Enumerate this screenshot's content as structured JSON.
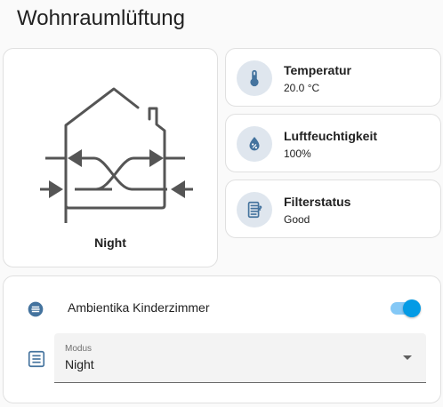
{
  "header": {
    "title": "Wohnraumlüftung"
  },
  "unit": {
    "mode_label": "Night"
  },
  "sensors": [
    {
      "name": "Temperatur",
      "value": "20.0 °C",
      "icon": "thermometer-icon"
    },
    {
      "name": "Luftfeuchtigkeit",
      "value": "100%",
      "icon": "humidity-icon"
    },
    {
      "name": "Filterstatus",
      "value": "Good",
      "icon": "air-filter-icon"
    }
  ],
  "entities": {
    "fan": {
      "name": "Ambientika Kinderzimmer",
      "icon": "fan-icon",
      "state": true
    },
    "mode": {
      "label": "Modus",
      "value": "Night",
      "icon": "form-select-icon",
      "options": [
        "Night"
      ]
    }
  },
  "colors": {
    "accent": "#039be5",
    "icon": "#44739e",
    "icon_bg": "#dfe6ee"
  }
}
